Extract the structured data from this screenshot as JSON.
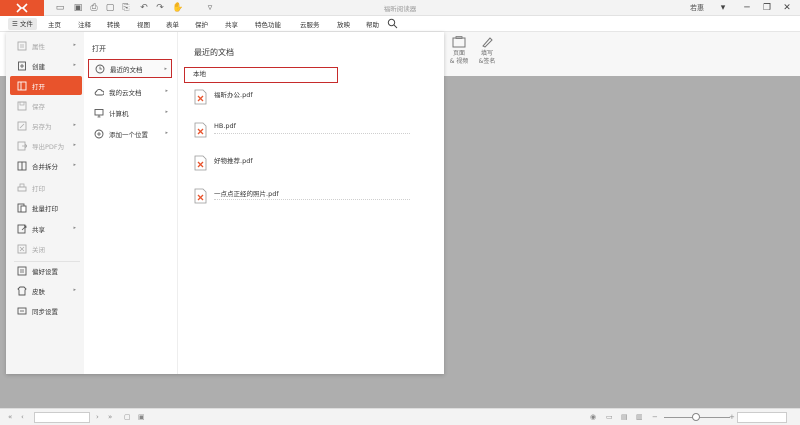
{
  "app": {
    "title": "福昕阅读器",
    "logo_icon": "foxit-logo-icon",
    "user_name": "若惠"
  },
  "menubar": {
    "file_label": "☰ 文件",
    "items": [
      "主页",
      "注释",
      "转换",
      "视图",
      "表单",
      "保护",
      "共享",
      "特色功能",
      "云服务",
      "放映",
      "帮助"
    ]
  },
  "toolbar": {
    "tools": [
      {
        "label": "页面\n& 视频",
        "icon": "page-video-icon"
      },
      {
        "label": "填写\n&签名",
        "icon": "pen-icon"
      }
    ]
  },
  "file_menu": {
    "left_items": [
      {
        "label": "属性",
        "icon": "properties-icon",
        "disabled": true,
        "arrow": true
      },
      {
        "label": "创建",
        "icon": "create-icon",
        "disabled": false,
        "arrow": true
      },
      {
        "label": "打开",
        "icon": "open-icon",
        "disabled": false,
        "arrow": false,
        "active": true
      },
      {
        "label": "保存",
        "icon": "save-icon",
        "disabled": true,
        "arrow": false
      },
      {
        "label": "另存为",
        "icon": "save-as-icon",
        "disabled": true,
        "arrow": true
      },
      {
        "label": "导出PDF为",
        "icon": "export-pdf-icon",
        "disabled": true,
        "arrow": true
      },
      {
        "label": "合并拆分",
        "icon": "merge-split-icon",
        "disabled": false,
        "arrow": true
      },
      {
        "label": "打印",
        "icon": "print-icon",
        "disabled": true,
        "arrow": false
      },
      {
        "label": "批量打印",
        "icon": "batch-print-icon",
        "disabled": false,
        "arrow": false
      },
      {
        "label": "共享",
        "icon": "share-icon",
        "disabled": false,
        "arrow": true
      },
      {
        "label": "关闭",
        "icon": "close-icon",
        "disabled": true,
        "arrow": false
      },
      {
        "label": "偏好设置",
        "icon": "preferences-icon",
        "disabled": false,
        "arrow": false
      },
      {
        "label": "皮肤",
        "icon": "skin-icon",
        "disabled": false,
        "arrow": true
      },
      {
        "label": "同步设置",
        "icon": "sync-icon",
        "disabled": false,
        "arrow": false
      }
    ],
    "open_heading": "打开",
    "open_items": [
      {
        "label": "最近的文档",
        "icon": "clock-icon",
        "selected": true
      },
      {
        "label": "我的云文档",
        "icon": "cloud-icon",
        "selected": false
      },
      {
        "label": "计算机",
        "icon": "computer-icon",
        "selected": false
      },
      {
        "label": "添加一个位置",
        "icon": "add-location-icon",
        "selected": false
      }
    ],
    "recent": {
      "title": "最近的文档",
      "tab": "本地",
      "docs": [
        {
          "name": "福昕办公.pdf"
        },
        {
          "name": "HB.pdf"
        },
        {
          "name": "好物推荐.pdf"
        },
        {
          "name": "一点点正经的照片.pdf"
        }
      ]
    }
  },
  "colors": {
    "accent": "#e8532c",
    "highlight_border": "#c62b2b",
    "workspace": "#aeaeae"
  }
}
